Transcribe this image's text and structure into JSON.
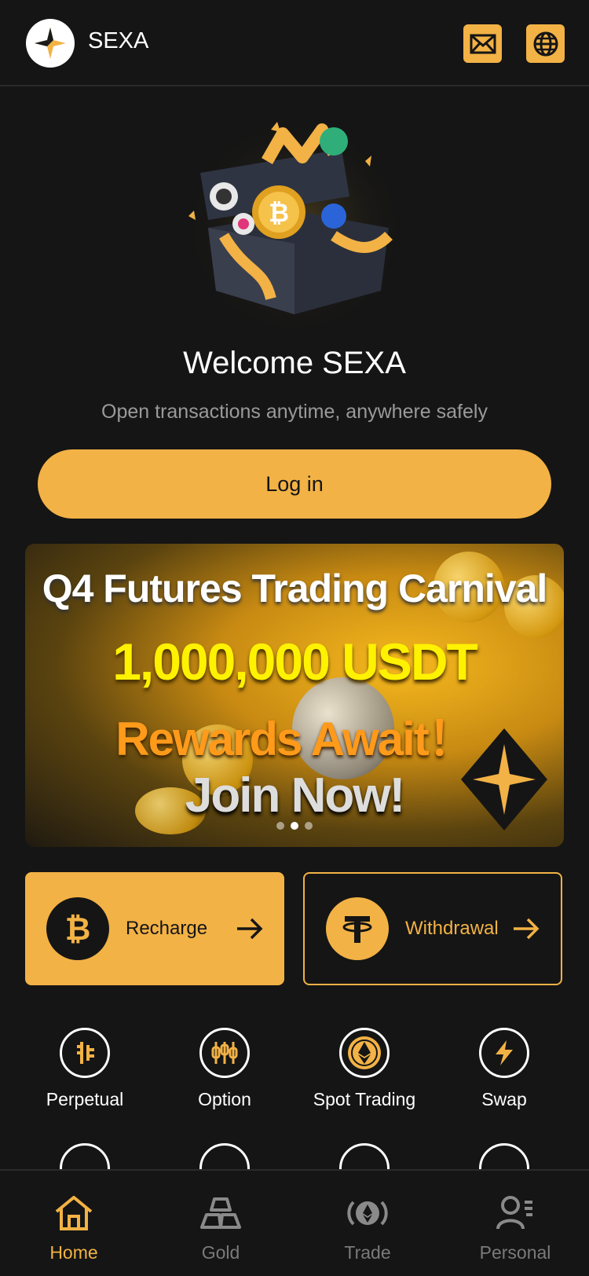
{
  "header": {
    "brand": "SEXA",
    "mail_icon": "envelope-icon",
    "language_icon": "globe-icon"
  },
  "welcome": {
    "title": "Welcome SEXA",
    "subtitle": "Open transactions anytime, anywhere safely",
    "login_label": "Log in"
  },
  "banner": {
    "line1": "Q4 Futures Trading Carnival",
    "line2": "1,000,000 USDT",
    "line3": "Rewards Await！",
    "line4": "Join Now!",
    "slide_count": 3,
    "active_slide": 2
  },
  "actions": {
    "recharge": {
      "label": "Recharge",
      "icon": "bitcoin-icon"
    },
    "withdrawal": {
      "label": "Withdrawal",
      "icon": "tether-icon"
    }
  },
  "features": [
    {
      "label": "Perpetual",
      "icon": "perpetual-icon"
    },
    {
      "label": "Option",
      "icon": "candlestick-icon"
    },
    {
      "label": "Spot Trading",
      "icon": "ethereum-icon"
    },
    {
      "label": "Swap",
      "icon": "lightning-icon"
    }
  ],
  "tabs": [
    {
      "label": "Home",
      "icon": "home-icon",
      "active": true
    },
    {
      "label": "Gold",
      "icon": "gold-bars-icon",
      "active": false
    },
    {
      "label": "Trade",
      "icon": "trade-icon",
      "active": false
    },
    {
      "label": "Personal",
      "icon": "user-icon",
      "active": false
    }
  ],
  "colors": {
    "accent": "#f2b245",
    "background": "#151515",
    "muted_text": "#9a9a9a",
    "inactive_tab": "#7a7a7a"
  }
}
